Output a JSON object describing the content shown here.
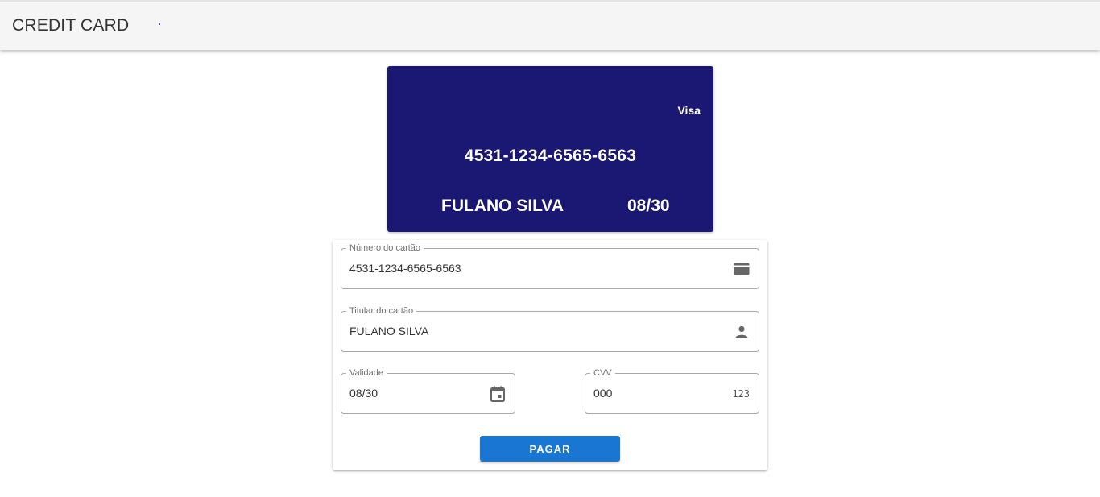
{
  "app": {
    "title": "CREDIT CARD"
  },
  "card_preview": {
    "brand": "Visa",
    "number": "4531-1234-6565-6563",
    "holder": "FULANO SILVA",
    "expiry": "08/30",
    "background_color": "#1a1872"
  },
  "form": {
    "card_number": {
      "label": "Número do cartão",
      "value": "4531-1234-6565-6563",
      "icon": "credit-card-icon"
    },
    "holder": {
      "label": "Titular do cartão",
      "value": "FULANO SILVA",
      "icon": "person-icon"
    },
    "expiry": {
      "label": "Validade",
      "value": "08/30",
      "icon": "calendar-icon"
    },
    "cvv": {
      "label": "CVV",
      "value": "000",
      "icon": "numeric-icon",
      "icon_text": "123"
    },
    "submit_label": "PAGAR",
    "submit_color": "#1976d2"
  }
}
